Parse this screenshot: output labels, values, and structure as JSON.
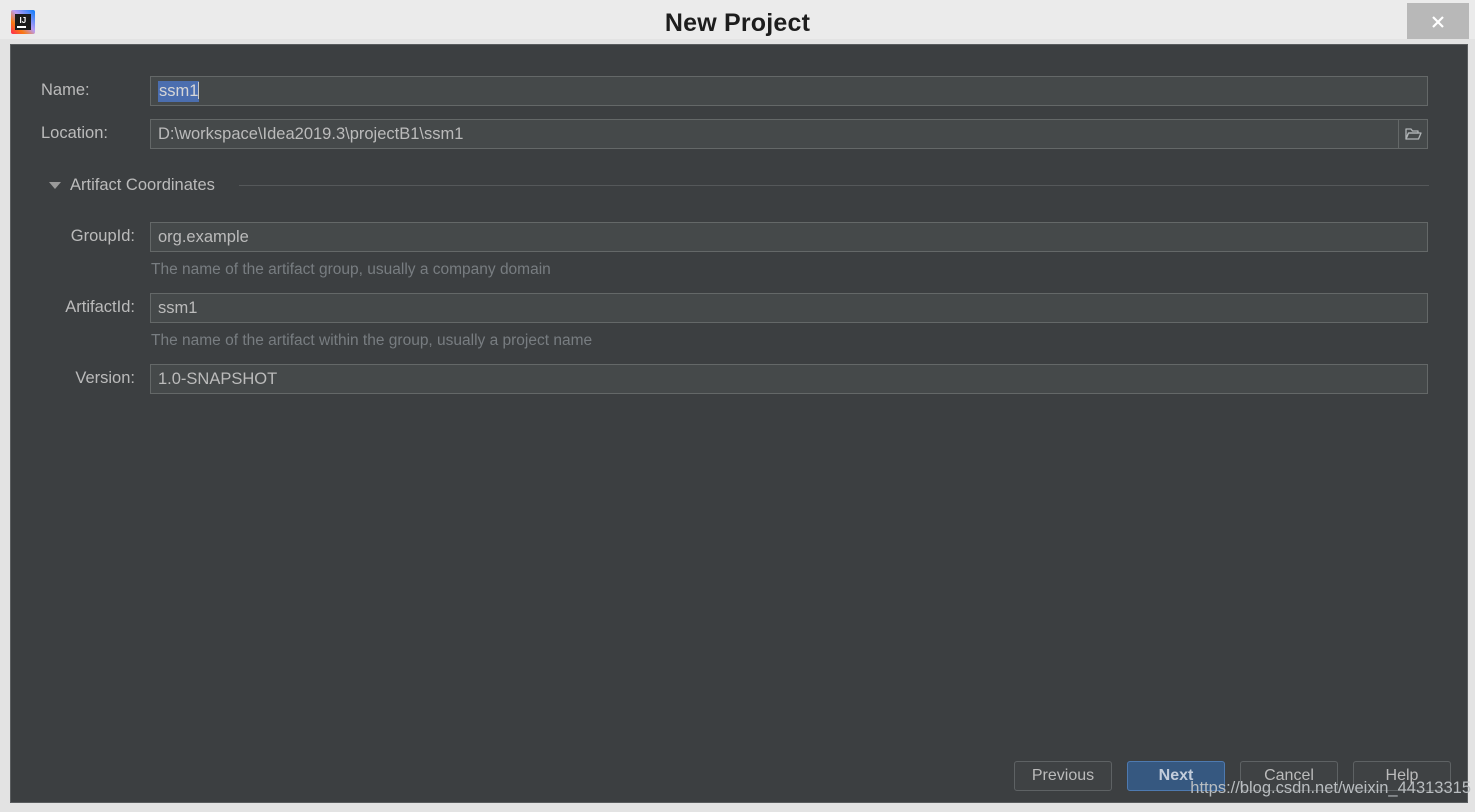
{
  "window": {
    "title": "New Project",
    "app_icon_name": "intellij-idea-logo",
    "close_label": "✕"
  },
  "form": {
    "name": {
      "label": "Name:",
      "value": "ssm1",
      "selected": true
    },
    "location": {
      "label": "Location:",
      "value": "D:\\workspace\\Idea2019.3\\projectB1\\ssm1",
      "browse_icon": "folder-icon"
    },
    "section": {
      "title": "Artifact Coordinates",
      "expanded": true,
      "toggle_icon": "triangle-down-icon"
    },
    "group_id": {
      "label": "GroupId:",
      "value": "org.example",
      "hint": "The name of the artifact group, usually a company domain"
    },
    "artifact_id": {
      "label": "ArtifactId:",
      "value": "ssm1",
      "hint": "The name of the artifact within the group, usually a project name"
    },
    "version": {
      "label": "Version:",
      "value": "1.0-SNAPSHOT"
    }
  },
  "buttons": {
    "previous": "Previous",
    "next": "Next",
    "cancel": "Cancel",
    "help": "Help"
  },
  "watermark": "https://blog.csdn.net/weixin_44313315",
  "colors": {
    "dialog_bg": "#3c3f41",
    "field_bg": "#45494a",
    "titlebar_bg": "#ebebeb",
    "selection_blue": "#4b6eaf",
    "default_button_blue": "#365880",
    "label_text": "#bbbbbb",
    "hint_text": "#787d81"
  }
}
